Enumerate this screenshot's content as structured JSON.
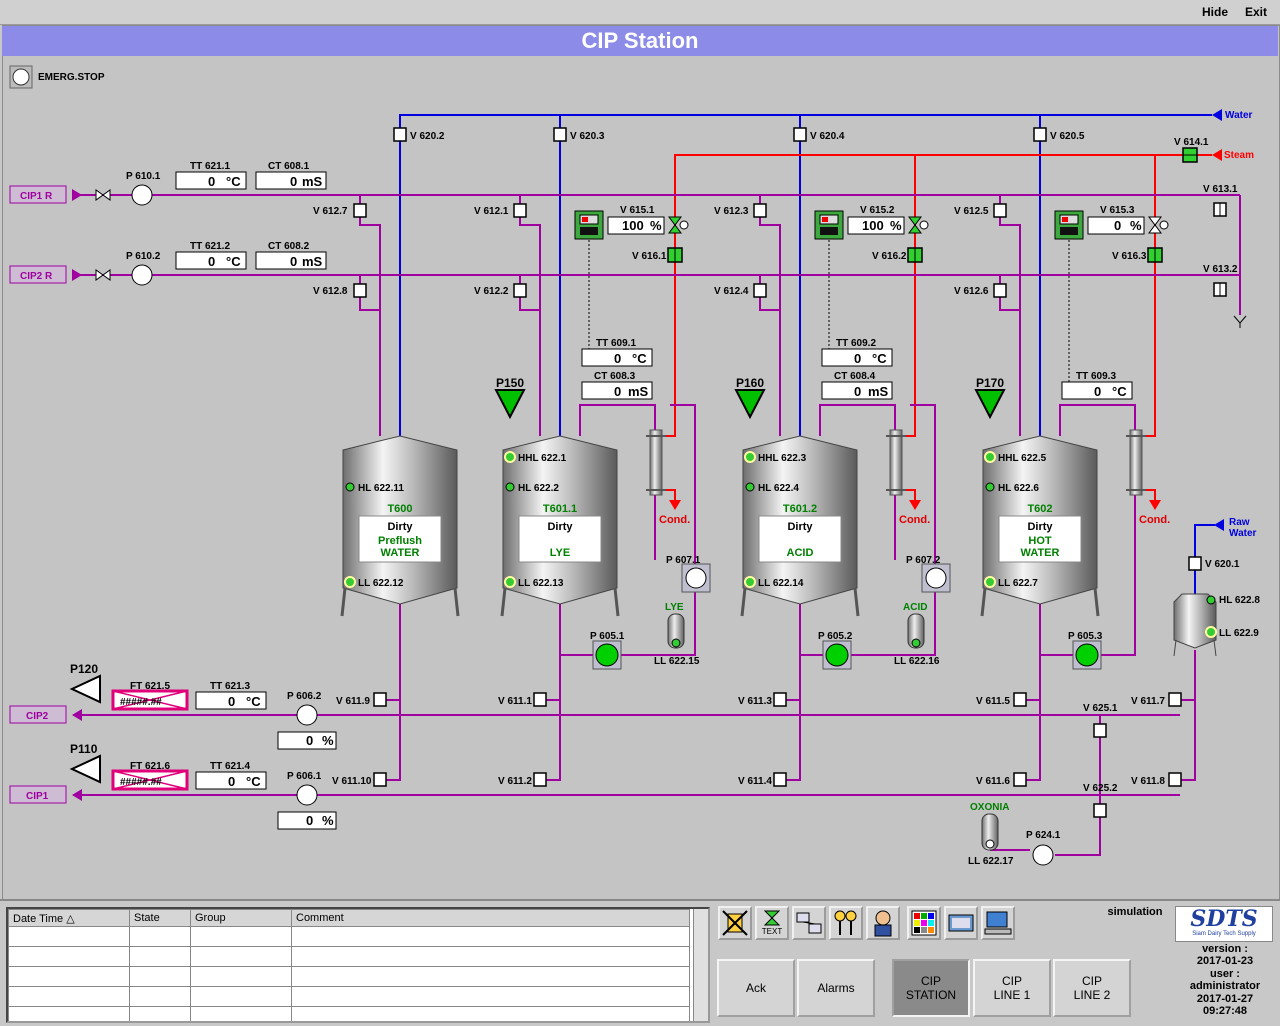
{
  "topbar": {
    "hide": "Hide",
    "exit": "Exit"
  },
  "title": "CIP Station",
  "emerg": "EMERG.STOP",
  "supply": {
    "water": "Water",
    "steam": "Steam",
    "raw_water": "Raw\nWater"
  },
  "lines": {
    "cip1r": "CIP1 R",
    "cip2r": "CIP2 R",
    "cip1": "CIP1",
    "cip2": "CIP2"
  },
  "pumps": {
    "p6101": "P 610.1",
    "p6102": "P 610.2",
    "p6062": "P 606.2",
    "p6061": "P 606.1",
    "p6071": "P 607.1",
    "p6072": "P 607.2",
    "p6051": "P 605.1",
    "p6052": "P 605.2",
    "p6053": "P 605.3",
    "p6241": "P 624.1"
  },
  "transmitters": {
    "tt6211": {
      "label": "TT 621.1",
      "value": "0",
      "unit": "°C"
    },
    "ct6081": {
      "label": "CT 608.1",
      "value": "0",
      "unit": "mS"
    },
    "tt6212": {
      "label": "TT 621.2",
      "value": "0",
      "unit": "°C"
    },
    "ct6082": {
      "label": "CT 608.2",
      "value": "0",
      "unit": "mS"
    },
    "tt6091": {
      "label": "TT 609.1",
      "value": "0",
      "unit": "°C"
    },
    "ct6083": {
      "label": "CT 608.3",
      "value": "0",
      "unit": "mS"
    },
    "tt6092": {
      "label": "TT 609.2",
      "value": "0",
      "unit": "°C"
    },
    "ct6084": {
      "label": "CT 608.4",
      "value": "0",
      "unit": "mS"
    },
    "tt6093": {
      "label": "TT 609.3",
      "value": "0",
      "unit": "°C"
    },
    "tt6213": {
      "label": "TT 621.3",
      "value": "0",
      "unit": "°C"
    },
    "tt6214": {
      "label": "TT 621.4",
      "value": "0",
      "unit": "°C"
    },
    "ft6215": {
      "label": "FT 621.5",
      "value": "#####.##"
    },
    "ft6216": {
      "label": "FT 621.6",
      "value": "#####.##"
    },
    "v6151": {
      "label": "V 615.1",
      "value": "100",
      "unit": "%"
    },
    "v6152": {
      "label": "V 615.2",
      "value": "100",
      "unit": "%"
    },
    "v6153": {
      "label": "V 615.3",
      "value": "0",
      "unit": "%"
    },
    "p6062pct": {
      "value": "0",
      "unit": "%"
    },
    "p6061pct": {
      "value": "0",
      "unit": "%"
    }
  },
  "valves": {
    "v6202": "V 620.2",
    "v6203": "V 620.3",
    "v6204": "V 620.4",
    "v6205": "V 620.5",
    "v6141": "V 614.1",
    "v6127": "V 612.7",
    "v6121": "V 612.1",
    "v6123": "V 612.3",
    "v6125": "V 612.5",
    "v6131": "V 613.1",
    "v6128": "V 612.8",
    "v6122": "V 612.2",
    "v6124": "V 612.4",
    "v6126": "V 612.6",
    "v6132": "V 613.2",
    "v6161": "V 616.1",
    "v6162": "V 616.2",
    "v6163": "V 616.3",
    "v6119": "V 611.9",
    "v6111": "V 611.1",
    "v6113": "V 611.3",
    "v6115": "V 611.5",
    "v6117": "V 611.7",
    "v61110": "V 611.10",
    "v6112": "V 611.2",
    "v6114": "V 611.4",
    "v6116": "V 611.6",
    "v6118": "V 611.8",
    "v6251": "V 625.1",
    "v6252": "V 625.2",
    "v6201": "V 620.1"
  },
  "levels": {
    "hl62211": "HL 622.11",
    "ll62212": "LL 622.12",
    "hhl6221": "HHL 622.1",
    "hl6222": "HL 622.2",
    "ll62213": "LL 622.13",
    "hhl6223": "HHL 622.3",
    "hl6224": "HL 622.4",
    "ll62214": "LL 622.14",
    "hhl6225": "HHL 622.5",
    "hl6226": "HL 622.6",
    "ll6227": "LL 622.7",
    "hl6228": "HL 622.8",
    "ll6229": "LL 622.9",
    "ll62215": "LL 622.15",
    "ll62216": "LL 622.16",
    "ll62217": "LL 622.17"
  },
  "tanks": [
    {
      "id": "T600",
      "state": "Dirty",
      "content": "Preflush\nWATER"
    },
    {
      "id": "T601.1",
      "state": "Dirty",
      "content": "LYE"
    },
    {
      "id": "T601.2",
      "state": "Dirty",
      "content": "ACID"
    },
    {
      "id": "T602",
      "state": "Dirty",
      "content": "HOT\nWATER"
    }
  ],
  "dosing": {
    "p150": "P150",
    "p160": "P160",
    "p170": "P170",
    "p120": "P120",
    "p110": "P110",
    "lye": "LYE",
    "acid": "ACID",
    "oxonia": "OXONIA"
  },
  "cond": "Cond.",
  "alarm_table": {
    "headers": [
      "Date Time",
      "State",
      "Group",
      "Comment"
    ],
    "rows": 5
  },
  "toolbar": {
    "text_label": "TEXT"
  },
  "buttons": {
    "ack": "Ack",
    "alarms": "Alarms",
    "cip_station": "CIP\nSTATION",
    "cip_line1": "CIP\nLINE 1",
    "cip_line2": "CIP\nLINE 2"
  },
  "info": {
    "mode": "simulation",
    "logo": "SDTS",
    "logo_sub": "Siam Dairy Tech Supply",
    "version_label": "version :",
    "version": "2017-01-23",
    "user_label": "user :",
    "user": "administrator",
    "date": "2017-01-27",
    "time": "09:27:48"
  },
  "colors": {
    "water": "#0000e0",
    "steam": "#ff0000",
    "cip": "#a000a0",
    "panel": "#c4c4c4",
    "title": "#8c8ce8"
  }
}
